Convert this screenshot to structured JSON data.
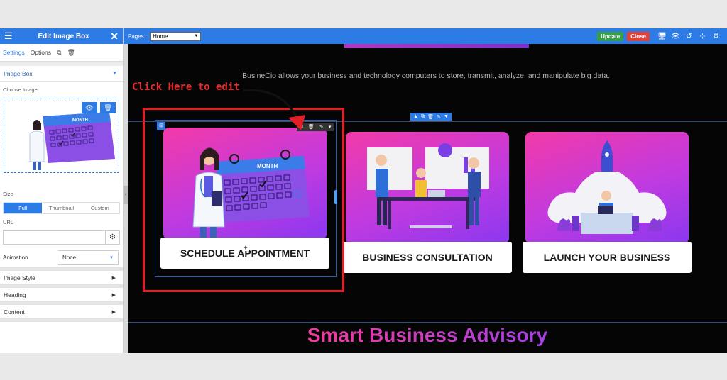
{
  "panel": {
    "title": "Edit Image Box",
    "tabs": [
      "Settings",
      "Options"
    ],
    "image_box_section": "Image Box",
    "choose_image_label": "Choose Image",
    "size_label": "Size",
    "size_options": [
      "Full",
      "Thumbnail",
      "Custom"
    ],
    "size_selected": "Full",
    "url_label": "URL",
    "url_value": "",
    "animation_label": "Animation",
    "animation_value": "None",
    "collapsed_sections": [
      "Image Style",
      "Heading",
      "Content"
    ]
  },
  "toolbar": {
    "pages_label": "Pages :",
    "pages_value": "Home",
    "update_label": "Update",
    "close_label": "Close"
  },
  "canvas": {
    "intro_text": "BusineCio allows your business and technology computers to store, transmit, analyze, and manipulate big data.",
    "callout": "Click Here to edit",
    "cards": [
      {
        "title": "SCHEDULE APPOINTMENT",
        "illustration": "calendar-doctor"
      },
      {
        "title": "BUSINESS CONSULTATION",
        "illustration": "team-meeting"
      },
      {
        "title": "LAUNCH YOUR BUSINESS",
        "illustration": "rocket-launch"
      }
    ],
    "bottom_heading": "Smart Business Advisory"
  },
  "colors": {
    "accent": "#2d7be5",
    "update": "#35a047",
    "close": "#e0423a",
    "highlight": "#e21f26",
    "card_gradient_start": "#f33aa8",
    "card_gradient_end": "#8a38f0"
  }
}
